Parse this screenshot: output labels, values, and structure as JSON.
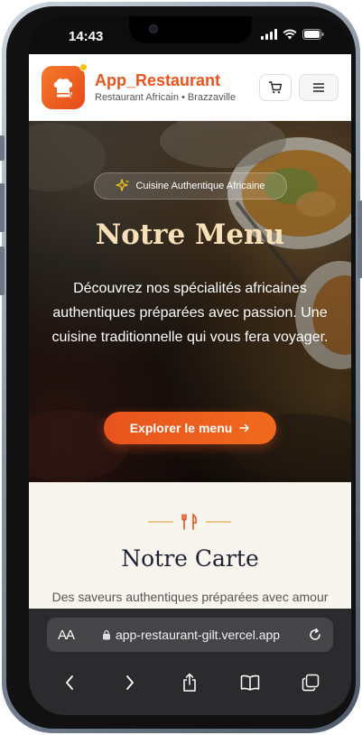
{
  "status_bar": {
    "time": "14:43"
  },
  "header": {
    "app_name": "App_Restaurant",
    "subtitle": "Restaurant Africain • Brazzaville"
  },
  "hero": {
    "badge": "Cuisine Authentique Africaine",
    "title": "Notre Menu",
    "description": "Découvrez nos spécialités africaines authentiques préparées avec passion. Une cuisine traditionnelle qui vous fera voyager.",
    "cta_label": "Explorer le menu"
  },
  "section": {
    "title": "Notre Carte",
    "subtitle": "Des saveurs authentiques préparées avec amour et tradition"
  },
  "browser": {
    "aa_label": "AA",
    "url": "app-restaurant-gilt.vercel.app"
  },
  "colors": {
    "accent": "#e8541e",
    "hero_title": "#f7e0b8",
    "section_bg": "#f8f5ef",
    "browser_bg": "#2b2b2d"
  }
}
